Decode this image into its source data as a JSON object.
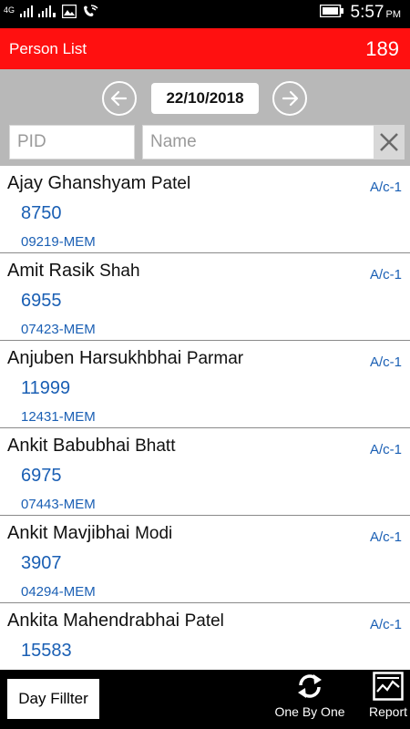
{
  "status_bar": {
    "network": "4G",
    "time": "5:57",
    "ampm": "PM",
    "icons": [
      "signal-icon",
      "signal-icon",
      "image-icon",
      "wifi-call-icon",
      "battery-icon"
    ]
  },
  "header": {
    "title": "Person List",
    "count": "189",
    "color": "#ff1010"
  },
  "filter": {
    "date": "22/10/2018",
    "pid_placeholder": "PID",
    "name_placeholder": "Name"
  },
  "persons": [
    {
      "first": "Ajay Ghanshyam",
      "last": "Patel",
      "account": "A/c-1",
      "number": "8750",
      "code": "09219-MEM"
    },
    {
      "first": "Amit Rasik",
      "last": "Shah",
      "account": "A/c-1",
      "number": "6955",
      "code": "07423-MEM"
    },
    {
      "first": "Anjuben Harsukhbhai",
      "last": "Parmar",
      "account": "A/c-1",
      "number": "11999",
      "code": "12431-MEM"
    },
    {
      "first": "Ankit Babubhai",
      "last": "Bhatt",
      "account": "A/c-1",
      "number": "6975",
      "code": "07443-MEM"
    },
    {
      "first": "Ankit Mavjibhai",
      "last": "Modi",
      "account": "A/c-1",
      "number": "3907",
      "code": "04294-MEM"
    },
    {
      "first": "Ankita Mahendrabhai",
      "last": "Patel",
      "account": "A/c-1",
      "number": "15583",
      "code": ""
    }
  ],
  "bottom_bar": {
    "day_filter": "Day Fillter",
    "one_by_one": "One By One",
    "report": "Report"
  },
  "colors": {
    "link_blue": "#1a5fb4",
    "filter_grey": "#b8b8b8"
  }
}
